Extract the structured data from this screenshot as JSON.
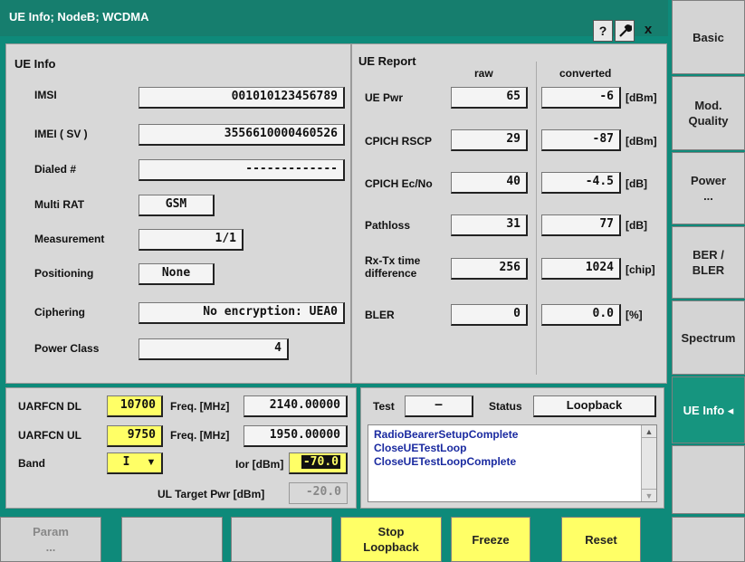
{
  "window": {
    "title": "UE Info; NodeB; WCDMA",
    "help_label": "?",
    "close_label": "x"
  },
  "ue_info": {
    "heading": "UE Info",
    "rows": [
      {
        "label": "IMSI",
        "value": "001010123456789"
      },
      {
        "label": "IMEI ( SV )",
        "value": "3556610000460526"
      },
      {
        "label": "Dialed #",
        "value": "-------------"
      },
      {
        "label": "Multi RAT",
        "value": "GSM"
      },
      {
        "label": "Measurement",
        "value": "1/1"
      },
      {
        "label": "Positioning",
        "value": "None"
      },
      {
        "label": "Ciphering",
        "value": "No encryption: UEA0"
      },
      {
        "label": "Power Class",
        "value": "4"
      }
    ]
  },
  "ue_report": {
    "heading": "UE Report",
    "col_raw": "raw",
    "col_converted": "converted",
    "rows": [
      {
        "label": "UE Pwr",
        "raw": "65",
        "converted": "-6",
        "unit": "[dBm]"
      },
      {
        "label": "CPICH RSCP",
        "raw": "29",
        "converted": "-87",
        "unit": "[dBm]"
      },
      {
        "label": "CPICH Ec/No",
        "raw": "40",
        "converted": "-4.5",
        "unit": "[dB]"
      },
      {
        "label": "Pathloss",
        "raw": "31",
        "converted": "77",
        "unit": "[dB]"
      },
      {
        "label": "Rx-Tx time\ndifference",
        "raw": "256",
        "converted": "1024",
        "unit": "[chip]"
      },
      {
        "label": "BLER",
        "raw": "0",
        "converted": "0.0",
        "unit": "[%]"
      }
    ]
  },
  "channel": {
    "uarfcn_dl_label": "UARFCN DL",
    "uarfcn_dl": "10700",
    "uarfcn_ul_label": "UARFCN UL",
    "uarfcn_ul": "9750",
    "band_label": "Band",
    "band": "I",
    "freq_label": "Freq. [MHz]",
    "freq_dl": "2140.00000",
    "freq_ul": "1950.00000",
    "ior_label": "Ior [dBm]",
    "ior": "-70.0",
    "ul_target_label": "UL Target Pwr [dBm]",
    "ul_target": "-20.0"
  },
  "test": {
    "test_label": "Test",
    "test_value": "—",
    "status_label": "Status",
    "status_value": "Loopback",
    "messages": [
      "RadioBearerSetupComplete",
      "CloseUETestLoop",
      "CloseUETestLoopComplete"
    ]
  },
  "side_keys": [
    {
      "label": "Basic"
    },
    {
      "label": "Mod.\nQuality"
    },
    {
      "label": "Power\n..."
    },
    {
      "label": "BER /\nBLER"
    },
    {
      "label": "Spectrum"
    },
    {
      "label": "UE Info ◂"
    },
    {
      "label": ""
    }
  ],
  "bottom_keys": [
    {
      "label": "Param\n..."
    },
    {
      "label": ""
    },
    {
      "label": ""
    },
    {
      "label": "Stop\nLoopback"
    },
    {
      "label": "Freeze"
    },
    {
      "label": "Reset"
    },
    {
      "label": ""
    }
  ],
  "colors": {
    "accent": "#16957f",
    "highlight": "#ffff66",
    "message_text": "#1a2aa0"
  }
}
